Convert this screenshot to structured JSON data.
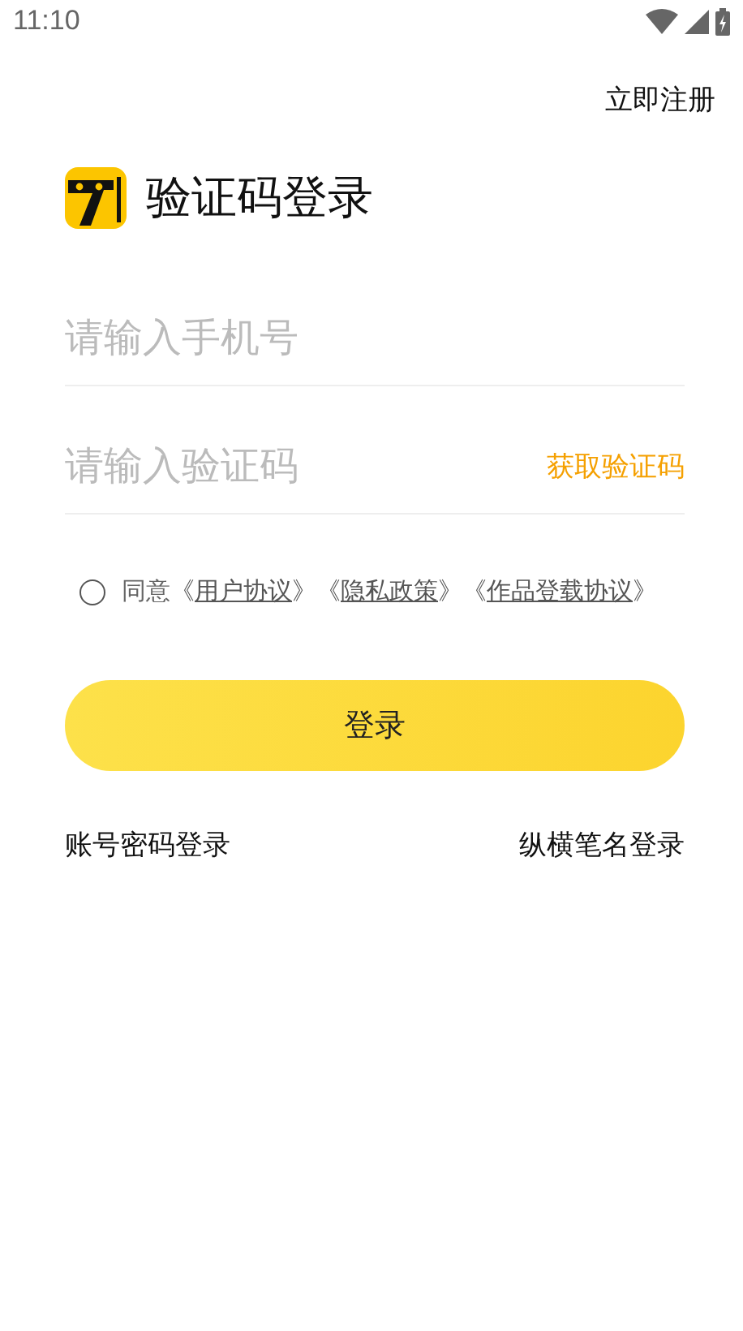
{
  "status_bar": {
    "time": "11:10"
  },
  "register_link": "立即注册",
  "title": "验证码登录",
  "phone_field": {
    "placeholder": "请输入手机号"
  },
  "code_field": {
    "placeholder": "请输入验证码",
    "action": "获取验证码"
  },
  "agreement": {
    "checked": false,
    "prefix": "同意",
    "links": [
      {
        "open": "《",
        "label": "用户协议",
        "close": "》"
      },
      {
        "open": "《",
        "label": "隐私政策",
        "close": "》"
      },
      {
        "open": "《",
        "label": "作品登载协议",
        "close": "》"
      }
    ]
  },
  "login_button": "登录",
  "alt_logins": [
    "账号密码登录",
    "纵横笔名登录"
  ]
}
